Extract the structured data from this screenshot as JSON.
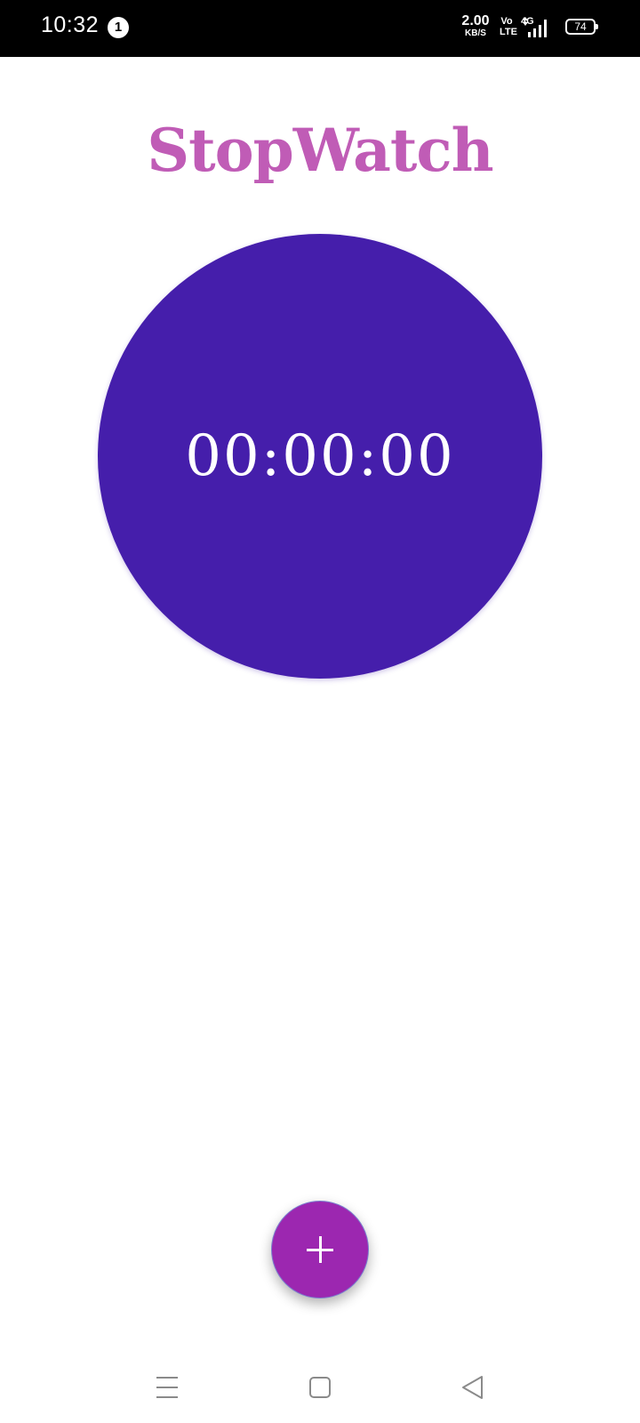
{
  "status_bar": {
    "time": "10:32",
    "notification_count": "1",
    "network_speed_value": "2.00",
    "network_speed_unit": "KB/S",
    "volte_top": "Vo",
    "volte_bottom": "LTE",
    "network_type": "4G",
    "battery_level": "74"
  },
  "app": {
    "title": "StopWatch",
    "title_color": "#c05cb6"
  },
  "stopwatch": {
    "time": "00:00:00",
    "circle_color": "#451eab"
  },
  "fab": {
    "icon": "plus-icon",
    "color": "#9c27b0"
  },
  "nav_bar": {
    "recents_icon": "menu-lines-icon",
    "home_icon": "square-icon",
    "back_icon": "triangle-back-icon"
  }
}
